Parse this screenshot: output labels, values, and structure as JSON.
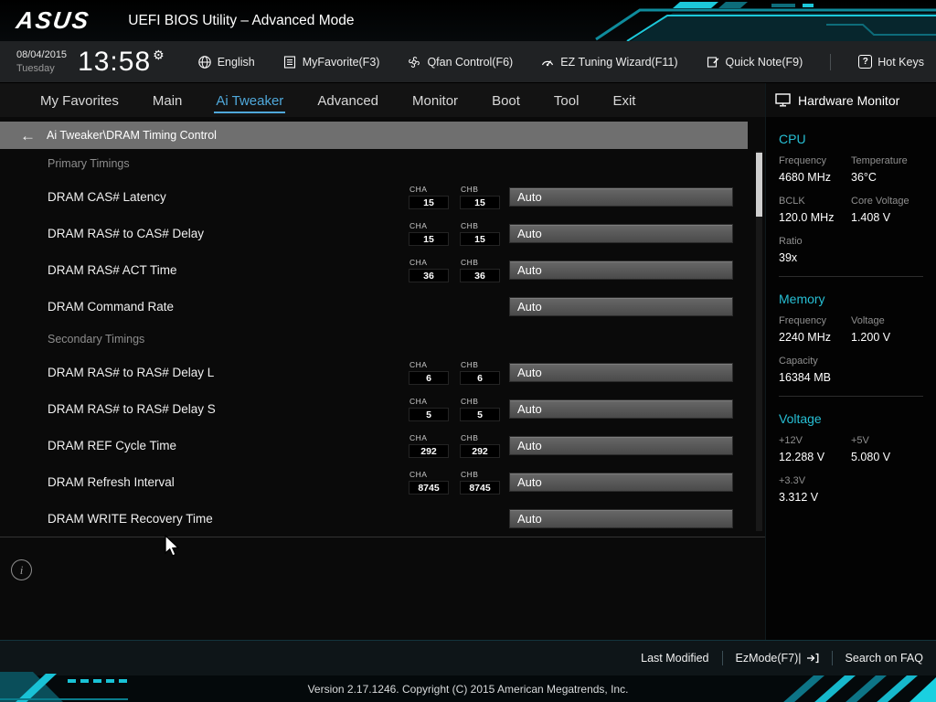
{
  "topbar": {
    "brand": "ASUS",
    "title": "UEFI BIOS Utility – Advanced Mode"
  },
  "toolbar": {
    "date": "08/04/2015",
    "day": "Tuesday",
    "time": "13:58",
    "items": [
      {
        "icon": "globe-icon",
        "label": "English"
      },
      {
        "icon": "myfavorite-icon",
        "label": "MyFavorite(F3)"
      },
      {
        "icon": "qfan-icon",
        "label": "Qfan Control(F6)"
      },
      {
        "icon": "ez-tuning-icon",
        "label": "EZ Tuning Wizard(F11)"
      },
      {
        "icon": "quick-note-icon",
        "label": "Quick Note(F9)"
      },
      {
        "icon": "hot-keys-icon",
        "label": "Hot Keys"
      }
    ]
  },
  "tabs": [
    {
      "label": "My Favorites",
      "active": false
    },
    {
      "label": "Main",
      "active": false
    },
    {
      "label": "Ai Tweaker",
      "active": true
    },
    {
      "label": "Advanced",
      "active": false
    },
    {
      "label": "Monitor",
      "active": false
    },
    {
      "label": "Boot",
      "active": false
    },
    {
      "label": "Tool",
      "active": false
    },
    {
      "label": "Exit",
      "active": false
    }
  ],
  "breadcrumb": {
    "label": "Ai Tweaker\\DRAM Timing Control"
  },
  "channel_labels": {
    "cha": "CHA",
    "chb": "CHB"
  },
  "sections": [
    {
      "title": "Primary Timings",
      "rows": [
        {
          "label": "DRAM CAS# Latency",
          "cha": "15",
          "chb": "15",
          "value": "Auto"
        },
        {
          "label": "DRAM RAS# to CAS# Delay",
          "cha": "15",
          "chb": "15",
          "value": "Auto"
        },
        {
          "label": "DRAM RAS# ACT Time",
          "cha": "36",
          "chb": "36",
          "value": "Auto"
        },
        {
          "label": "DRAM Command Rate",
          "value": "Auto"
        }
      ]
    },
    {
      "title": "Secondary Timings",
      "rows": [
        {
          "label": "DRAM RAS# to RAS# Delay L",
          "cha": "6",
          "chb": "6",
          "value": "Auto"
        },
        {
          "label": "DRAM RAS# to RAS# Delay S",
          "cha": "5",
          "chb": "5",
          "value": "Auto"
        },
        {
          "label": "DRAM REF Cycle Time",
          "cha": "292",
          "chb": "292",
          "value": "Auto"
        },
        {
          "label": "DRAM Refresh Interval",
          "cha": "8745",
          "chb": "8745",
          "value": "Auto"
        },
        {
          "label": "DRAM WRITE Recovery Time",
          "value": "Auto"
        }
      ]
    }
  ],
  "hardware_monitor": {
    "title": "Hardware Monitor",
    "cpu": {
      "title": "CPU",
      "rows": [
        {
          "label": "Frequency",
          "value": "4680 MHz"
        },
        {
          "label": "Temperature",
          "value": "36°C"
        },
        {
          "label": "BCLK",
          "value": "120.0 MHz"
        },
        {
          "label": "Core Voltage",
          "value": "1.408 V"
        },
        {
          "label": "Ratio",
          "value": "39x"
        }
      ]
    },
    "memory": {
      "title": "Memory",
      "rows": [
        {
          "label": "Frequency",
          "value": "2240 MHz"
        },
        {
          "label": "Voltage",
          "value": "1.200 V"
        },
        {
          "label": "Capacity",
          "value": "16384 MB"
        }
      ]
    },
    "voltage": {
      "title": "Voltage",
      "rows": [
        {
          "label": "+12V",
          "value": "12.288 V"
        },
        {
          "label": "+5V",
          "value": "5.080 V"
        },
        {
          "label": "+3.3V",
          "value": "3.312 V"
        }
      ]
    }
  },
  "footer": {
    "last_modified": "Last Modified",
    "ezmode": "EzMode(F7)|",
    "search_faq": "Search on FAQ",
    "version": "Version 2.17.1246. Copyright (C) 2015 American Megatrends, Inc."
  },
  "icons": {
    "gear": "⚙",
    "back_arrow": "←",
    "info": "i",
    "hotkeys_glyph": "?"
  },
  "colors": {
    "accent_teal": "#1cc8da",
    "tab_active": "#4fa8da",
    "section_title_teal": "#27bfd4"
  }
}
